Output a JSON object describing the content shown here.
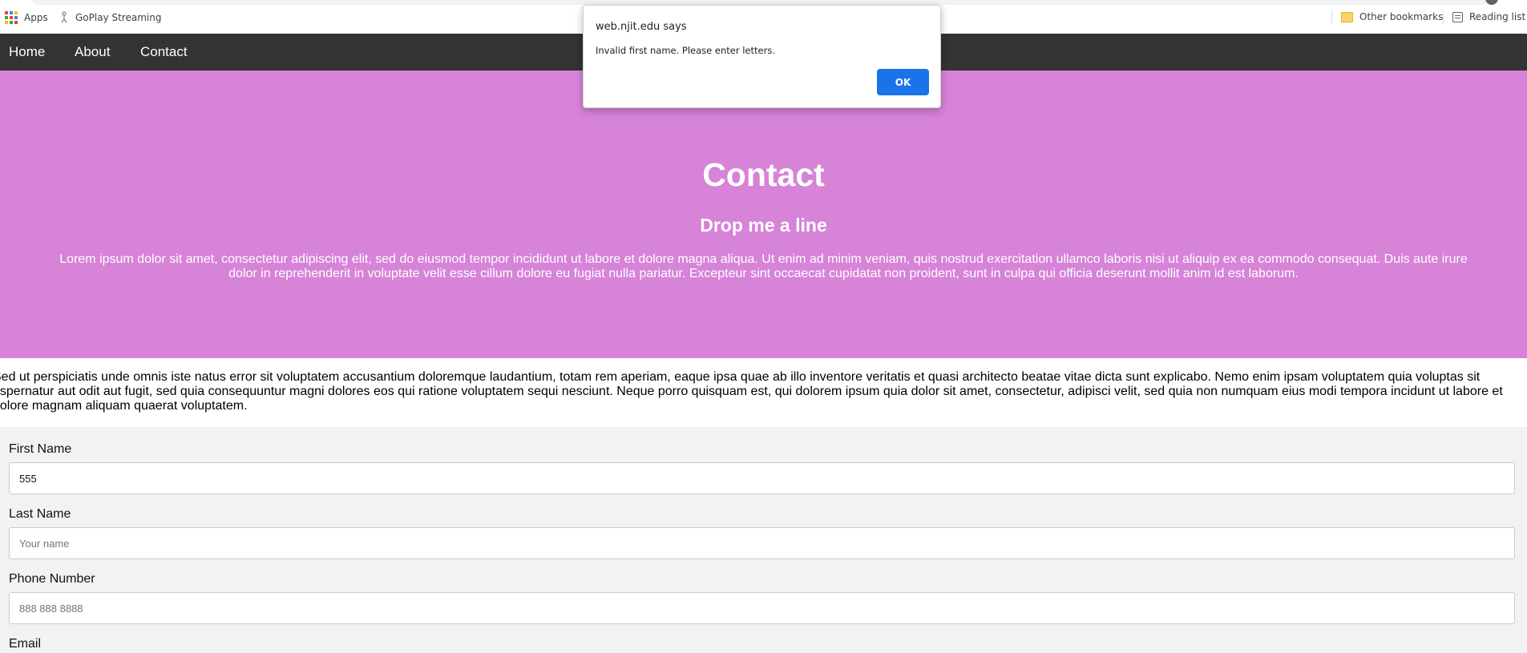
{
  "bookmarks_bar": {
    "apps_label": "Apps",
    "goplay_label": "GoPlay Streaming",
    "other_bookmarks_label": "Other bookmarks",
    "reading_list_label": "Reading list",
    "apps_grid_colors": [
      "#ea4335",
      "#4285f4",
      "#fbbc05",
      "#34a853",
      "#ea4335",
      "#4285f4",
      "#fbbc05",
      "#34a853",
      "#ea4335"
    ]
  },
  "nav": {
    "items": [
      {
        "label": "Home"
      },
      {
        "label": "About"
      },
      {
        "label": "Contact"
      }
    ]
  },
  "hero": {
    "title": "Contact",
    "subtitle": "Drop me a line",
    "text": "Lorem ipsum dolor sit amet, consectetur adipiscing elit, sed do eiusmod tempor incididunt ut labore et dolore magna aliqua. Ut enim ad minim veniam, quis nostrud exercitation ullamco laboris nisi ut aliquip ex ea commodo consequat. Duis aute irure dolor in reprehenderit in voluptate velit esse cillum dolore eu fugiat nulla pariatur. Excepteur sint occaecat cupidatat non proident, sunt in culpa qui officia deserunt mollit anim id est laborum.",
    "background": "#d683d8"
  },
  "intro": {
    "text": "Sed ut perspiciatis unde omnis iste natus error sit voluptatem accusantium doloremque laudantium, totam rem aperiam, eaque ipsa quae ab illo inventore veritatis et quasi architecto beatae vitae dicta sunt explicabo. Nemo enim ipsam voluptatem quia voluptas sit aspernatur aut odit aut fugit, sed quia consequuntur magni dolores eos qui ratione voluptatem sequi nesciunt. Neque porro quisquam est, qui dolorem ipsum quia dolor sit amet, consectetur, adipisci velit, sed quia non numquam eius modi tempora incidunt ut labore et dolore magnam aliquam quaerat voluptatem."
  },
  "form": {
    "first_name": {
      "label": "First Name",
      "value": "555",
      "placeholder": ""
    },
    "last_name": {
      "label": "Last Name",
      "value": "",
      "placeholder": "Your name"
    },
    "phone": {
      "label": "Phone Number",
      "value": "",
      "placeholder": "888 888 8888"
    },
    "email": {
      "label": "Email"
    }
  },
  "dialog": {
    "title": "web.njit.edu says",
    "message": "Invalid first name. Please enter letters.",
    "ok_label": "OK",
    "ok_color": "#1a73e8"
  }
}
